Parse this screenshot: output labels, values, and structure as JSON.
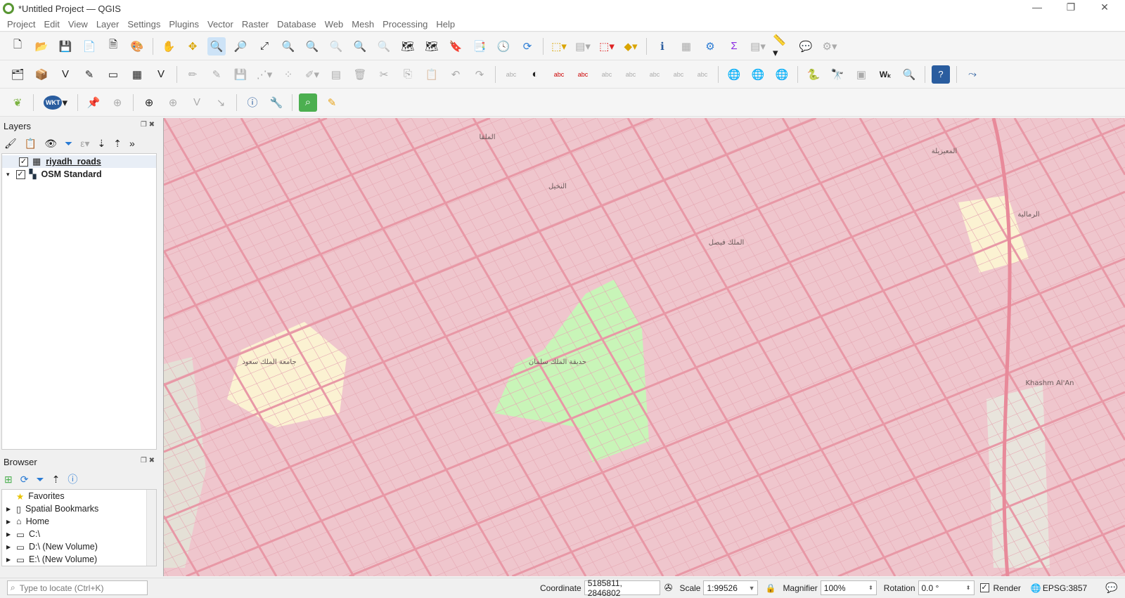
{
  "window": {
    "title": "*Untitled Project — QGIS"
  },
  "menu": [
    "Project",
    "Edit",
    "View",
    "Layer",
    "Settings",
    "Plugins",
    "Vector",
    "Raster",
    "Database",
    "Web",
    "Mesh",
    "Processing",
    "Help"
  ],
  "layers_panel": {
    "title": "Layers",
    "items": [
      {
        "name": "riyadh_roads",
        "checked": true,
        "icon": "grid-icon"
      },
      {
        "name": "OSM Standard",
        "checked": true,
        "icon": "raster-tile-icon"
      }
    ]
  },
  "browser_panel": {
    "title": "Browser",
    "items": [
      "Favorites",
      "Spatial Bookmarks",
      "Home",
      "C:\\",
      "D:\\ (New Volume)",
      "E:\\ (New Volume)"
    ]
  },
  "locator": {
    "placeholder": "Type to locate (Ctrl+K)"
  },
  "status": {
    "coordinate_label": "Coordinate",
    "coordinate": "5185811, 2846802",
    "scale_label": "Scale",
    "scale": "1:99526",
    "magnifier_label": "Magnifier",
    "magnifier": "100%",
    "rotation_label": "Rotation",
    "rotation": "0.0 °",
    "render_label": "Render",
    "render_checked": true,
    "crs": "EPSG:3857"
  },
  "map": {
    "labels": [
      "حديقة الملك سلمان",
      "جامعة الملك سعود",
      "Khashm Al'An",
      "الرمالية",
      "المعيزيلة",
      "الملك فيصل",
      "النخيل",
      "الملقا"
    ],
    "colors": {
      "background": "#efc6cd",
      "road": "#e898a6",
      "park": "#c8f5b8",
      "campus": "#fbf2d2"
    }
  },
  "wkt_label": "WKT"
}
